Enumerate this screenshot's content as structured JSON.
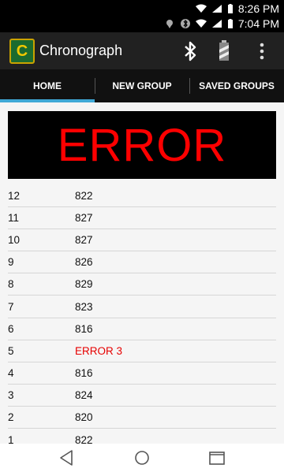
{
  "status": {
    "time_top": "8:26 PM",
    "time_bottom": "7:04 PM"
  },
  "app": {
    "title": "Chronograph",
    "logo_letter": "C",
    "icons": [
      "bluetooth-icon",
      "battery-icon",
      "overflow-menu-icon"
    ]
  },
  "tabs": [
    {
      "label": "HOME",
      "active": true
    },
    {
      "label": "NEW GROUP",
      "active": false
    },
    {
      "label": "SAVED GROUPS",
      "active": false
    }
  ],
  "display": {
    "text": "ERROR",
    "color": "#ff0000"
  },
  "shots": [
    {
      "n": "12",
      "v": "822"
    },
    {
      "n": "11",
      "v": "827"
    },
    {
      "n": "10",
      "v": "827"
    },
    {
      "n": "9",
      "v": "826"
    },
    {
      "n": "8",
      "v": "829"
    },
    {
      "n": "7",
      "v": "823"
    },
    {
      "n": "6",
      "v": "816"
    },
    {
      "n": "5",
      "v": "ERROR 3"
    },
    {
      "n": "4",
      "v": "816"
    },
    {
      "n": "3",
      "v": "824"
    },
    {
      "n": "2",
      "v": "820"
    },
    {
      "n": "1",
      "v": "822"
    }
  ],
  "colors": {
    "accent": "#3fa8d6",
    "error": "#e60000"
  }
}
